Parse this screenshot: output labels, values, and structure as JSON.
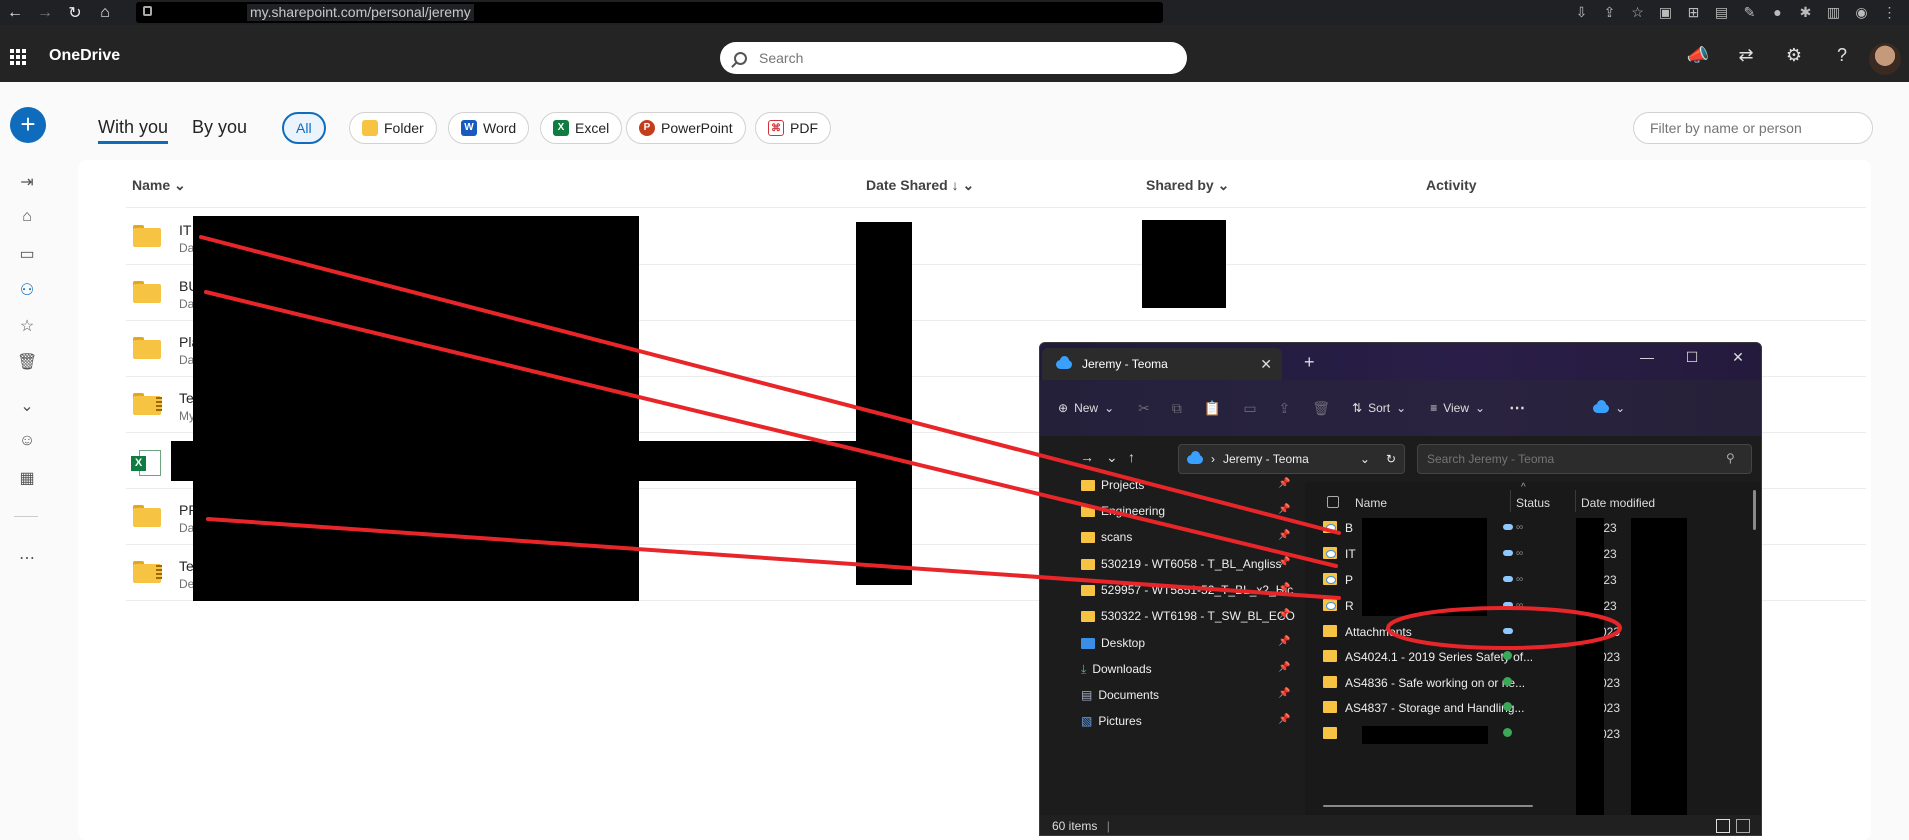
{
  "browser": {
    "url": "my.sharepoint.com/personal/jeremy"
  },
  "app": {
    "name": "OneDrive",
    "search_placeholder": "Search"
  },
  "tabs": [
    {
      "label": "With you",
      "active": true
    },
    {
      "label": "By you",
      "active": false
    }
  ],
  "filters": [
    {
      "label": "All",
      "active": true
    },
    {
      "label": "Folder"
    },
    {
      "label": "Word"
    },
    {
      "label": "Excel"
    },
    {
      "label": "PowerPoint"
    },
    {
      "label": "PDF"
    }
  ],
  "filter_box_placeholder": "Filter by name or person",
  "columns": {
    "name": "Name",
    "date_shared": "Date Shared",
    "shared_by": "Shared by",
    "activity": "Activity"
  },
  "rows": [
    {
      "name": "IT",
      "sub": "Da",
      "icon": "folder"
    },
    {
      "name": "BU",
      "sub": "Da",
      "icon": "folder"
    },
    {
      "name": "Pla",
      "sub": "Da",
      "icon": "folder"
    },
    {
      "name": "Te",
      "sub": "My",
      "icon": "zip-folder"
    },
    {
      "name": "",
      "sub": "",
      "icon": "excel"
    },
    {
      "name": "PR",
      "sub": "Da",
      "icon": "folder"
    },
    {
      "name": "Te",
      "sub": "De",
      "icon": "zip-folder"
    }
  ],
  "explorer": {
    "tab_title": "Jeremy - Teoma",
    "commands": {
      "new": "New",
      "sort": "Sort",
      "view": "View"
    },
    "address": "Jeremy - Teoma",
    "search_placeholder": "Search Jeremy - Teoma",
    "nav_items": [
      {
        "label": "Projects",
        "icon": "folder"
      },
      {
        "label": "Engineering",
        "icon": "folder"
      },
      {
        "label": "scans",
        "icon": "folder"
      },
      {
        "label": "530219 - WT6058 - T_BL_Angliss",
        "icon": "folder"
      },
      {
        "label": "529957 - WT5851-52_T_BL_x2_Hic",
        "icon": "folder"
      },
      {
        "label": "530322 - WT6198 - T_SW_BL_ECO",
        "icon": "folder"
      },
      {
        "label": "Desktop",
        "icon": "desktop"
      },
      {
        "label": "Downloads",
        "icon": "download"
      },
      {
        "label": "Documents",
        "icon": "document"
      },
      {
        "label": "Pictures",
        "icon": "picture"
      }
    ],
    "headers": {
      "name": "Name",
      "status": "Status",
      "date_modified": "Date modified"
    },
    "files": [
      {
        "name": "B",
        "status": "cloud",
        "date": "2023"
      },
      {
        "name": "IT",
        "status": "cloud",
        "date": "2023"
      },
      {
        "name": "P",
        "status": "cloud",
        "date": "2023"
      },
      {
        "name": "R",
        "status": "cloud",
        "date": "2023"
      },
      {
        "name": "Attachments",
        "status": "cloud",
        "date": "/2023"
      },
      {
        "name": "AS4024.1 - 2019 Series Safety of...",
        "status": "ok",
        "date": "/2023"
      },
      {
        "name": "AS4836 - Safe working on or ne...",
        "status": "ok",
        "date": "/2023"
      },
      {
        "name": "AS4837 - Storage and Handling...",
        "status": "ok",
        "date": "/2023"
      },
      {
        "name": "",
        "status": "ok",
        "date": "/2023"
      }
    ],
    "item_count": "60 items"
  },
  "colors": {
    "accent": "#0f6cbd",
    "annotation": "#e8262a",
    "folder": "#f6c343"
  }
}
